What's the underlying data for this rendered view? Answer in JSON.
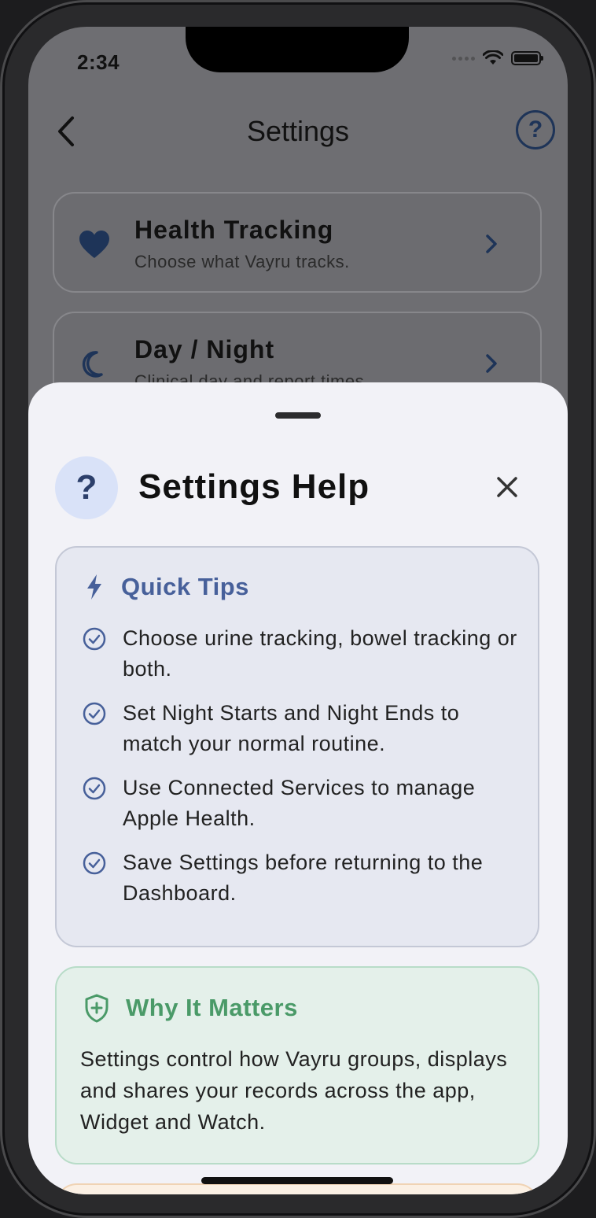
{
  "status_bar": {
    "time": "2:34"
  },
  "nav": {
    "title": "Settings"
  },
  "settings_list": [
    {
      "title": "Health Tracking",
      "subtitle": "Choose what Vayru tracks.",
      "icon": "heart-icon"
    },
    {
      "title": "Day / Night",
      "subtitle": "Clinical day and report times",
      "icon": "moon-icon"
    }
  ],
  "sheet": {
    "badge": "?",
    "title": "Settings Help",
    "quick_tips": {
      "heading": "Quick Tips",
      "icon": "bolt-icon",
      "items": [
        "Choose urine tracking, bowel tracking or both.",
        "Set Night Starts and Night Ends to match your normal routine.",
        "Use Connected Services to manage Apple Health.",
        "Save Settings before returning to the Dashboard."
      ]
    },
    "why_it_matters": {
      "heading": "Why It Matters",
      "icon": "shield-plus-icon",
      "text": "Settings control how Vayru groups, displays and shares your records across the app, Widget and Watch."
    }
  },
  "colors": {
    "accent_blue": "#47609a",
    "accent_green": "#4a9a68",
    "nav_blue": "#1e3458"
  }
}
